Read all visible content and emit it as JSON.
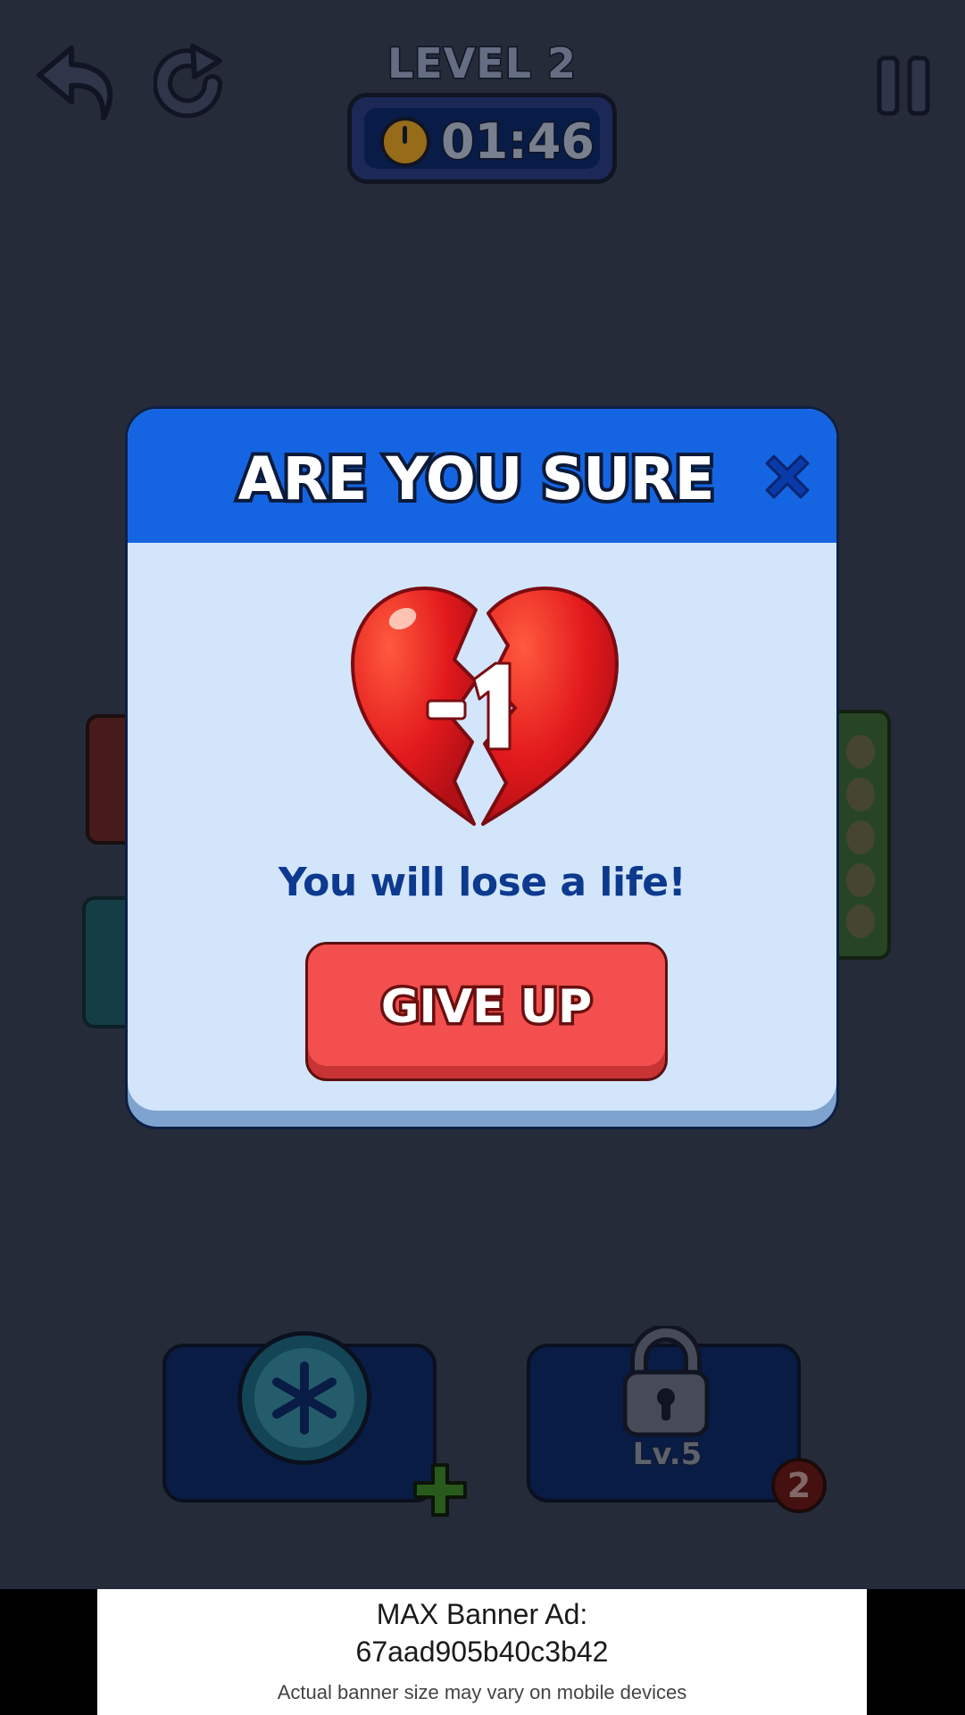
{
  "header": {
    "level_title": "LEVEL 2",
    "timer": "01:46",
    "icons": [
      "undo-icon",
      "redo-icon",
      "pause-icon",
      "clock-icon"
    ]
  },
  "boosters": {
    "freeze": {
      "icon": "snowflake-icon",
      "add_icon": "plus-icon"
    },
    "locked": {
      "icon": "lock-icon",
      "label": "Lv.5",
      "badge": "2"
    }
  },
  "modal": {
    "title": "ARE YOU SURE",
    "heart_badge": "-1",
    "message": "You will lose a life!",
    "give_up_label": "GIVE UP",
    "icons": [
      "close-icon",
      "broken-heart-icon"
    ]
  },
  "ad": {
    "line1": "MAX Banner Ad:",
    "line2": "67aad905b40c3b42",
    "line3": "Actual banner size may vary on mobile devices"
  },
  "colors": {
    "modal_header": "#1565e2",
    "modal_body": "#d2e5fb",
    "give_up": "#f34f4f",
    "message_text": "#0d3a8e"
  }
}
